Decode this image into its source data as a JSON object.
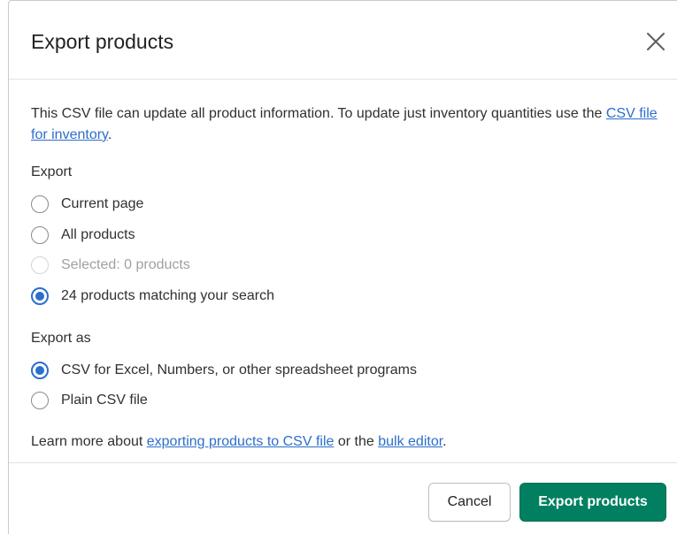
{
  "modal": {
    "title": "Export products",
    "description_text": "This CSV file can update all product information. To update just inventory quantities use the ",
    "description_link": "CSV file for inventory",
    "description_end": "."
  },
  "export_section": {
    "label": "Export",
    "options": [
      {
        "label": "Current page",
        "checked": false,
        "disabled": false
      },
      {
        "label": "All products",
        "checked": false,
        "disabled": false
      },
      {
        "label": "Selected: 0 products",
        "checked": false,
        "disabled": true
      },
      {
        "label": "24 products matching your search",
        "checked": true,
        "disabled": false
      }
    ]
  },
  "export_as_section": {
    "label": "Export as",
    "options": [
      {
        "label": "CSV for Excel, Numbers, or other spreadsheet programs",
        "checked": true
      },
      {
        "label": "Plain CSV file",
        "checked": false
      }
    ]
  },
  "learn_more": {
    "prefix": "Learn more about ",
    "link1": "exporting products to CSV file",
    "middle": " or the ",
    "link2": "bulk editor",
    "suffix": "."
  },
  "footer": {
    "cancel_label": "Cancel",
    "export_label": "Export products"
  },
  "icons": {
    "close": "close-icon"
  },
  "colors": {
    "primary": "#008060",
    "link": "#2c6ecb",
    "radio_checked": "#2c6ecb"
  }
}
